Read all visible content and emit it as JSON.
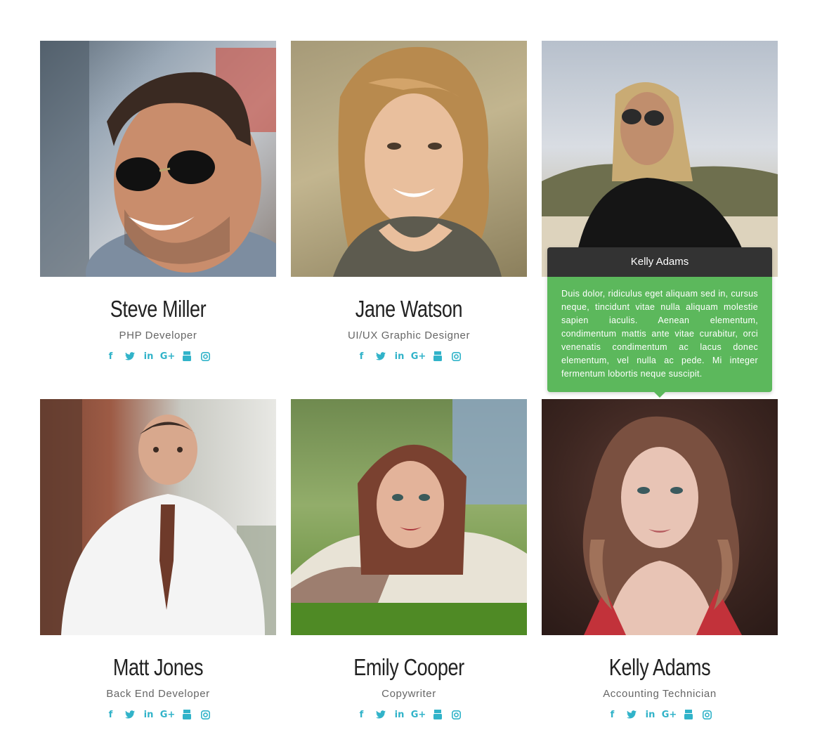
{
  "team": [
    {
      "name": "Steve Miller",
      "role": "PHP Developer"
    },
    {
      "name": "Jane Watson",
      "role": "UI/UX Graphic Designer"
    },
    {
      "name": "Kelly Adams",
      "role": "Accounting Technician"
    },
    {
      "name": "Matt Jones",
      "role": "Back End Developer"
    },
    {
      "name": "Emily Cooper",
      "role": "Copywriter"
    },
    {
      "name": "Kelly Adams",
      "role": "Accounting Technician"
    }
  ],
  "social_icons": [
    "facebook-icon",
    "twitter-icon",
    "linkedin-icon",
    "google-plus-icon",
    "youtube-icon",
    "instagram-icon"
  ],
  "tooltip": {
    "title": "Kelly Adams",
    "text": "Duis dolor, ridiculus eget aliquam sed in, cursus neque, tincidunt vitae nulla aliquam molestie sapien iaculis. Aenean elementum, condimentum mattis ante vitae curabitur, orci venenatis condimentum ac lacus donec elementum, vel nulla ac pede. Mi integer fermentum lobortis neque suscipit."
  },
  "colors": {
    "accent": "#31b3c9",
    "tooltip_header": "#333333",
    "tooltip_body": "#5cb85c"
  }
}
